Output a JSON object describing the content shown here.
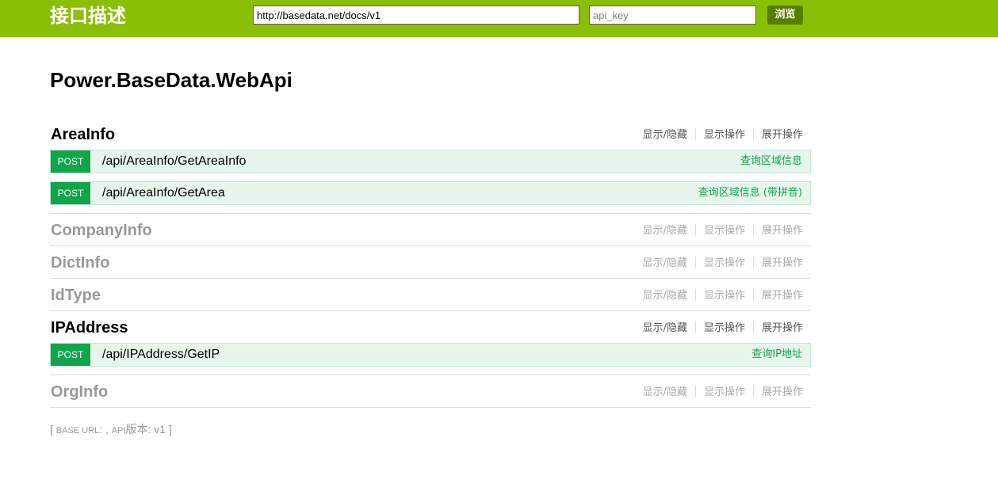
{
  "header": {
    "title": "接口描述",
    "url_value": "http://basedata.net/docs/v1",
    "api_key_placeholder": "api_key",
    "explore_label": "浏览"
  },
  "api_title": "Power.BaseData.WebApi",
  "links": {
    "show_hide": "显示/隐藏",
    "list_operations": "显示操作",
    "expand_operations": "展开操作"
  },
  "resources": [
    {
      "name": "AreaInfo",
      "expanded": true,
      "operations": [
        {
          "method": "POST",
          "path": "/api/AreaInfo/GetAreaInfo",
          "summary": "查询区域信息"
        },
        {
          "method": "POST",
          "path": "/api/AreaInfo/GetArea",
          "summary": "查询区域信息 (带拼音)"
        }
      ]
    },
    {
      "name": "CompanyInfo",
      "expanded": false,
      "operations": []
    },
    {
      "name": "DictInfo",
      "expanded": false,
      "operations": []
    },
    {
      "name": "IdType",
      "expanded": false,
      "operations": []
    },
    {
      "name": "IPAddress",
      "expanded": true,
      "operations": [
        {
          "method": "POST",
          "path": "/api/IPAddress/GetIP",
          "summary": "查询IP地址"
        }
      ]
    },
    {
      "name": "OrgInfo",
      "expanded": false,
      "operations": []
    }
  ],
  "footer": {
    "open": "[ ",
    "base_url_label": "BASE URL",
    "mid": ": , ",
    "api_label": "API",
    "version_label": "版本",
    "version": ": v1",
    "close": " ]"
  },
  "colors": {
    "header_bg": "#89bf04",
    "explore_bg": "#547f00",
    "post_method": "#10a54a",
    "post_bg": "#e7f6ec",
    "collapsed_text": "#999999"
  }
}
